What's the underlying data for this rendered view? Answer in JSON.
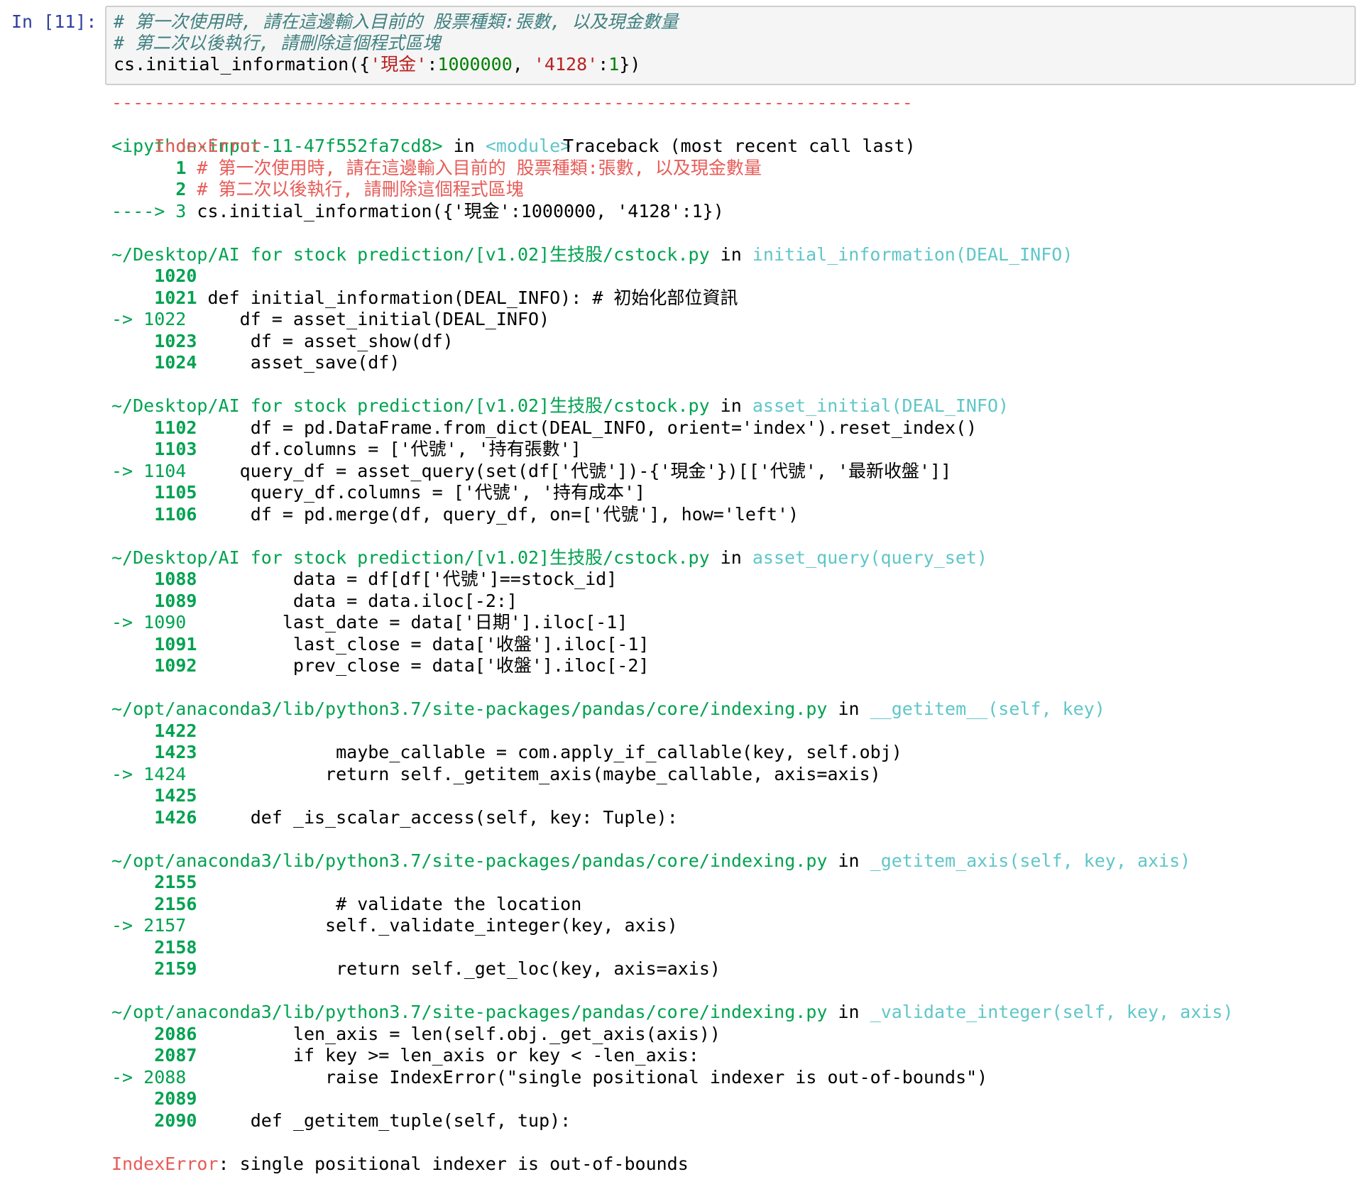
{
  "prompt_label": "In [11]:",
  "input_cell": {
    "line1": "# 第一次使用時, 請在這邊輸入目前的 股票種類:張數, 以及現金數量",
    "line2": "# 第二次以後執行, 請刪除這個程式區塊",
    "line3": {
      "call": "cs.initial_information({",
      "key1": "'現金'",
      "colon1": ":",
      "num1": "1000000",
      "sep": ", ",
      "key2": "'4128'",
      "colon2": ":",
      "num2": "1",
      "close": "})"
    }
  },
  "traceback": {
    "dashes": "---------------------------------------------------------------------------",
    "error_type": "IndexError",
    "header_right": "Traceback (most recent call last)",
    "input_ref": "<ipython-input-11-47f552fa7cd8>",
    "in_word": " in ",
    "module": "<module>",
    "cell_lines": [
      {
        "num": "1",
        "text": " # 第一次使用時, 請在這邊輸入目前的 股票種類:張數, 以及現金數量"
      },
      {
        "num": "2",
        "text": " # 第二次以後執行, 請刪除這個程式區塊"
      }
    ],
    "cell_arrow": "----> 3",
    "cell_current": " cs.initial_information({'現金':1000000, '4128':1})",
    "frames": [
      {
        "path": "~/Desktop/AI for stock prediction/[v1.02]生技股/cstock.py",
        "in_word": " in ",
        "func": "initial_information(DEAL_INFO)",
        "lines": [
          {
            "marker": "    ",
            "num": "1020",
            "code": ""
          },
          {
            "marker": "    ",
            "num": "1021",
            "code": " def initial_information(DEAL_INFO): # 初始化部位資訊"
          },
          {
            "marker": "-> ",
            "num": "1022",
            "code": "     df = asset_initial(DEAL_INFO)"
          },
          {
            "marker": "    ",
            "num": "1023",
            "code": "     df = asset_show(df)"
          },
          {
            "marker": "    ",
            "num": "1024",
            "code": "     asset_save(df)"
          }
        ]
      },
      {
        "path": "~/Desktop/AI for stock prediction/[v1.02]生技股/cstock.py",
        "in_word": " in ",
        "func": "asset_initial(DEAL_INFO)",
        "lines": [
          {
            "marker": "    ",
            "num": "1102",
            "code": "     df = pd.DataFrame.from_dict(DEAL_INFO, orient='index').reset_index()"
          },
          {
            "marker": "    ",
            "num": "1103",
            "code": "     df.columns = ['代號', '持有張數']"
          },
          {
            "marker": "-> ",
            "num": "1104",
            "code": "     query_df = asset_query(set(df['代號'])-{'現金'})[['代號', '最新收盤']]"
          },
          {
            "marker": "    ",
            "num": "1105",
            "code": "     query_df.columns = ['代號', '持有成本']"
          },
          {
            "marker": "    ",
            "num": "1106",
            "code": "     df = pd.merge(df, query_df, on=['代號'], how='left')"
          }
        ]
      },
      {
        "path": "~/Desktop/AI for stock prediction/[v1.02]生技股/cstock.py",
        "in_word": " in ",
        "func": "asset_query(query_set)",
        "lines": [
          {
            "marker": "    ",
            "num": "1088",
            "code": "         data = df[df['代號']==stock_id]"
          },
          {
            "marker": "    ",
            "num": "1089",
            "code": "         data = data.iloc[-2:]"
          },
          {
            "marker": "-> ",
            "num": "1090",
            "code": "         last_date = data['日期'].iloc[-1]"
          },
          {
            "marker": "    ",
            "num": "1091",
            "code": "         last_close = data['收盤'].iloc[-1]"
          },
          {
            "marker": "    ",
            "num": "1092",
            "code": "         prev_close = data['收盤'].iloc[-2]"
          }
        ]
      },
      {
        "path": "~/opt/anaconda3/lib/python3.7/site-packages/pandas/core/indexing.py",
        "in_word": " in ",
        "func": "__getitem__(self, key)",
        "lines": [
          {
            "marker": "    ",
            "num": "1422",
            "code": ""
          },
          {
            "marker": "    ",
            "num": "1423",
            "code": "             maybe_callable = com.apply_if_callable(key, self.obj)"
          },
          {
            "marker": "-> ",
            "num": "1424",
            "code": "             return self._getitem_axis(maybe_callable, axis=axis)"
          },
          {
            "marker": "    ",
            "num": "1425",
            "code": ""
          },
          {
            "marker": "    ",
            "num": "1426",
            "code": "     def _is_scalar_access(self, key: Tuple):"
          }
        ]
      },
      {
        "path": "~/opt/anaconda3/lib/python3.7/site-packages/pandas/core/indexing.py",
        "in_word": " in ",
        "func": "_getitem_axis(self, key, axis)",
        "lines": [
          {
            "marker": "    ",
            "num": "2155",
            "code": ""
          },
          {
            "marker": "    ",
            "num": "2156",
            "code": "             # validate the location"
          },
          {
            "marker": "-> ",
            "num": "2157",
            "code": "             self._validate_integer(key, axis)"
          },
          {
            "marker": "    ",
            "num": "2158",
            "code": ""
          },
          {
            "marker": "    ",
            "num": "2159",
            "code": "             return self._get_loc(key, axis=axis)"
          }
        ]
      },
      {
        "path": "~/opt/anaconda3/lib/python3.7/site-packages/pandas/core/indexing.py",
        "in_word": " in ",
        "func": "_validate_integer(self, key, axis)",
        "lines": [
          {
            "marker": "    ",
            "num": "2086",
            "code": "         len_axis = len(self.obj._get_axis(axis))"
          },
          {
            "marker": "    ",
            "num": "2087",
            "code": "         if key >= len_axis or key < -len_axis:"
          },
          {
            "marker": "-> ",
            "num": "2088",
            "code": "             raise IndexError(\"single positional indexer is out-of-bounds\")"
          },
          {
            "marker": "    ",
            "num": "2089",
            "code": ""
          },
          {
            "marker": "    ",
            "num": "2090",
            "code": "     def _getitem_tuple(self, tup):"
          }
        ]
      }
    ],
    "final_error_type": "IndexError",
    "final_message": ": single positional indexer is out-of-bounds"
  },
  "colors": {
    "prompt": "#303f9f",
    "cell_bg": "#f5f5f5",
    "cell_border": "#cfcfcf",
    "ansi_red": "#e75c58",
    "ansi_green": "#00a250",
    "ansi_cyan": "#60c6c8",
    "ansi_blue": "#208ffb"
  }
}
